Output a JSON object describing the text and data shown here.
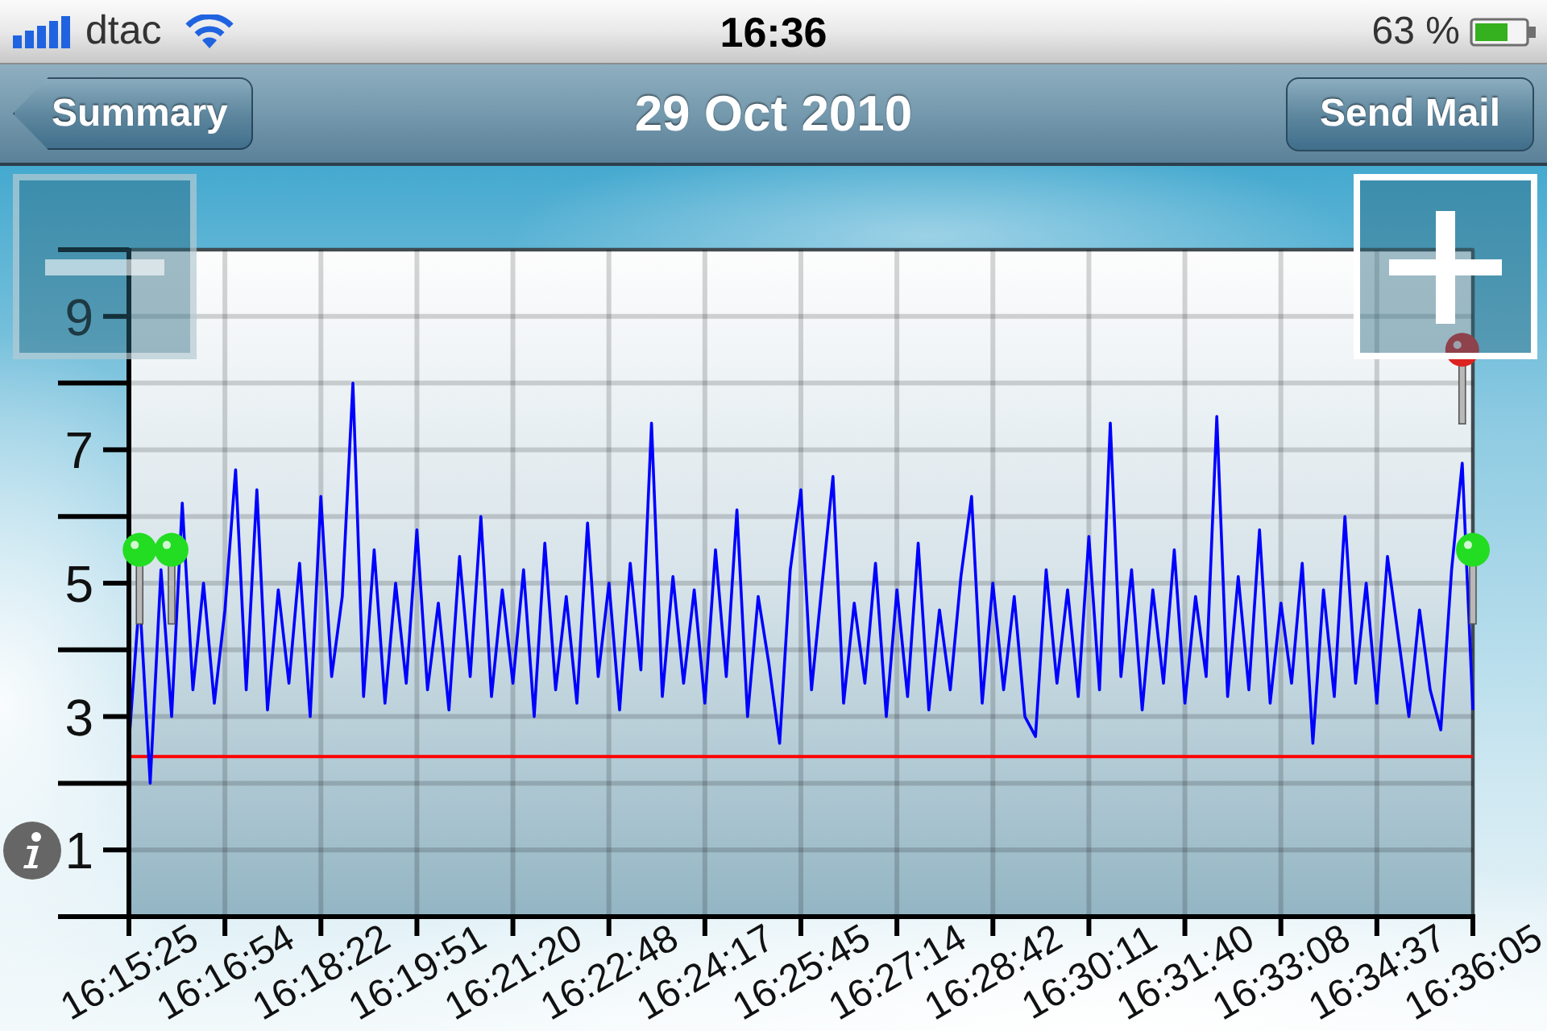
{
  "status_bar": {
    "carrier": "dtac",
    "time": "16:36",
    "battery": "63 %"
  },
  "nav_bar": {
    "back_button": "Summary",
    "title": "29 Oct 2010",
    "action_button": "Send Mail"
  },
  "zoom_controls": [
    {
      "kind": "minus",
      "disabled": true
    },
    {
      "kind": "plus",
      "disabled": false
    }
  ],
  "chart": {
    "chart_data": {
      "type": "line",
      "categories": [
        "16:15:25",
        null,
        null,
        null,
        null,
        null,
        null,
        null,
        null,
        "16:16:54",
        null,
        null,
        null,
        null,
        null,
        null,
        null,
        null,
        "16:18:22",
        null,
        null,
        null,
        null,
        null,
        null,
        null,
        null,
        "16:19:51",
        null,
        null,
        null,
        null,
        null,
        null,
        null,
        null,
        "16:21:20",
        null,
        null,
        null,
        null,
        null,
        null,
        null,
        null,
        "16:22:48",
        null,
        null,
        null,
        null,
        null,
        null,
        null,
        null,
        "16:24:17",
        null,
        null,
        null,
        null,
        null,
        null,
        null,
        null,
        "16:25:45",
        null,
        null,
        null,
        null,
        null,
        null,
        null,
        null,
        "16:27:14",
        null,
        null,
        null,
        null,
        null,
        null,
        null,
        null,
        "16:28:42",
        null,
        null,
        null,
        null,
        null,
        null,
        null,
        null,
        "16:30:11",
        null,
        null,
        null,
        null,
        null,
        null,
        null,
        null,
        "16:31:40",
        null,
        null,
        null,
        null,
        null,
        null,
        null,
        null,
        "16:33:08",
        null,
        null,
        null,
        null,
        null,
        null,
        null,
        null,
        "16:34:37",
        null,
        null,
        null,
        null,
        null,
        null,
        null,
        null,
        "16:36:05"
      ],
      "series": [
        {
          "color": "#0000ff",
          "values": [
            2.6,
            4.8,
            2.0,
            5.2,
            3.0,
            6.2,
            3.4,
            5.0,
            3.2,
            4.6,
            6.7,
            3.4,
            6.4,
            3.1,
            4.9,
            3.5,
            5.3,
            3.0,
            6.3,
            3.6,
            4.8,
            8.0,
            3.3,
            5.5,
            3.2,
            5.0,
            3.5,
            5.8,
            3.4,
            4.7,
            3.1,
            5.4,
            3.6,
            6.0,
            3.3,
            4.9,
            3.5,
            5.2,
            3.0,
            5.6,
            3.4,
            4.8,
            3.2,
            5.9,
            3.6,
            5.0,
            3.1,
            5.3,
            3.7,
            7.4,
            3.3,
            5.1,
            3.5,
            4.9,
            3.2,
            5.5,
            3.6,
            6.1,
            3.0,
            4.8,
            3.8,
            2.6,
            5.2,
            6.4,
            3.4,
            5.0,
            6.6,
            3.2,
            4.7,
            3.5,
            5.3,
            3.0,
            4.9,
            3.3,
            5.6,
            3.1,
            4.6,
            3.4,
            5.1,
            6.3,
            3.2,
            5.0,
            3.4,
            4.8,
            3.0,
            2.7,
            5.2,
            3.5,
            4.9,
            3.3,
            5.7,
            3.4,
            7.4,
            3.6,
            5.2,
            3.1,
            4.9,
            3.5,
            5.5,
            3.2,
            4.8,
            3.6,
            7.5,
            3.3,
            5.1,
            3.4,
            5.8,
            3.2,
            4.7,
            3.5,
            5.3,
            2.6,
            4.9,
            3.3,
            6.0,
            3.5,
            5.0,
            3.2,
            5.4,
            4.2,
            3.0,
            4.6,
            3.4,
            2.8,
            5.2,
            6.8,
            3.1
          ]
        },
        {
          "type": "scatter",
          "color": "#22dd22",
          "values": [
            null,
            5.5,
            null,
            null,
            5.5,
            null,
            null,
            null,
            null,
            null,
            null,
            null,
            null,
            null,
            null,
            null,
            null,
            null,
            null,
            null,
            null,
            null,
            null,
            null,
            null,
            null,
            null,
            null,
            null,
            null,
            null,
            null,
            null,
            null,
            null,
            null,
            null,
            null,
            null,
            null,
            null,
            null,
            null,
            null,
            null,
            null,
            null,
            null,
            null,
            null,
            null,
            null,
            null,
            null,
            null,
            null,
            null,
            null,
            null,
            null,
            null,
            null,
            null,
            null,
            null,
            null,
            null,
            null,
            null,
            null,
            null,
            null,
            null,
            null,
            null,
            null,
            null,
            null,
            null,
            null,
            null,
            null,
            null,
            null,
            null,
            null,
            null,
            null,
            null,
            null,
            null,
            null,
            null,
            null,
            null,
            null,
            null,
            null,
            null,
            null,
            null,
            null,
            null,
            null,
            null,
            null,
            null,
            null,
            null,
            null,
            null,
            null,
            null,
            null,
            null,
            null,
            null,
            null,
            null,
            null,
            null,
            null,
            null,
            null,
            null,
            null,
            5.5
          ]
        },
        {
          "type": "scatter",
          "color": "#dd2222",
          "values": [
            null,
            null,
            null,
            null,
            null,
            null,
            null,
            null,
            null,
            null,
            null,
            null,
            null,
            null,
            null,
            null,
            null,
            null,
            null,
            null,
            null,
            null,
            null,
            null,
            null,
            null,
            null,
            null,
            null,
            null,
            null,
            null,
            null,
            null,
            null,
            null,
            null,
            null,
            null,
            null,
            null,
            null,
            null,
            null,
            null,
            null,
            null,
            null,
            null,
            null,
            null,
            null,
            null,
            null,
            null,
            null,
            null,
            null,
            null,
            null,
            null,
            null,
            null,
            null,
            null,
            null,
            null,
            null,
            null,
            null,
            null,
            null,
            null,
            null,
            null,
            null,
            null,
            null,
            null,
            null,
            null,
            null,
            null,
            null,
            null,
            null,
            null,
            null,
            null,
            null,
            null,
            null,
            null,
            null,
            null,
            null,
            null,
            null,
            null,
            null,
            null,
            null,
            null,
            null,
            null,
            null,
            null,
            null,
            null,
            null,
            null,
            null,
            null,
            null,
            null,
            null,
            null,
            null,
            null,
            null,
            null,
            null,
            null,
            null,
            null,
            8.5,
            null
          ]
        }
      ],
      "ylim": [
        0,
        10
      ],
      "yticks": [
        1,
        3,
        5,
        7,
        9
      ],
      "grid": true,
      "ref_lines": [
        {
          "axis": "y",
          "value": 2.4,
          "color": "#ff0000"
        }
      ]
    }
  }
}
